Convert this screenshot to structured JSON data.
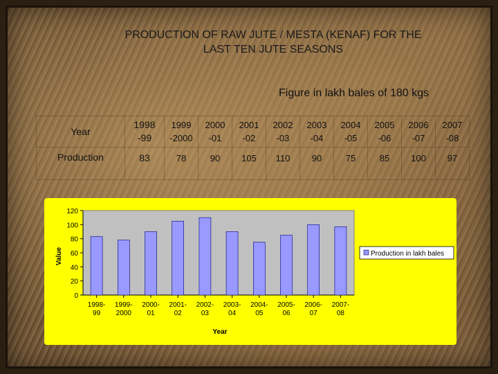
{
  "title_line1": "PRODUCTION OF RAW JUTE / MESTA (KENAF) FOR THE",
  "title_line2": "LAST TEN JUTE SEASONS",
  "unit_note": "Figure in lakh bales of 180 kgs",
  "table": {
    "year_label": "Year",
    "production_label": "Production",
    "years": [
      "1998\n-99",
      "1999\n-2000",
      "2000\n-01",
      "2001\n-02",
      "2002\n-03",
      "2003\n-04",
      "2004\n-05",
      "2005\n-06",
      "2006\n-07",
      "2007\n-08"
    ],
    "production": [
      "83",
      "78",
      "90",
      "105",
      "110",
      "90",
      "75",
      "85",
      "100",
      "97"
    ]
  },
  "colors": {
    "panel": "#ffff00",
    "plot_area": "#c0c0c0",
    "bar": "#9999ff"
  },
  "chart_data": {
    "type": "bar",
    "categories": [
      "1998-99",
      "1999-2000",
      "2000-01",
      "2001-02",
      "2002-03",
      "2003-04",
      "2004-05",
      "2005-06",
      "2006-07",
      "2007-08"
    ],
    "category_label_lines": [
      [
        "1998-",
        "99"
      ],
      [
        "1999-",
        "2000"
      ],
      [
        "2000-",
        "01"
      ],
      [
        "2001-",
        "02"
      ],
      [
        "2002-",
        "03"
      ],
      [
        "2003-",
        "04"
      ],
      [
        "2004-",
        "05"
      ],
      [
        "2005-",
        "06"
      ],
      [
        "2006-",
        "07"
      ],
      [
        "2007-",
        "08"
      ]
    ],
    "series": [
      {
        "name": "Production in lakh bales",
        "values": [
          83,
          78,
          90,
          105,
          110,
          90,
          75,
          85,
          100,
          97
        ]
      }
    ],
    "xlabel": "Year",
    "ylabel": "Value",
    "ylim": [
      0,
      120
    ],
    "yticks": [
      0,
      20,
      40,
      60,
      80,
      100,
      120
    ],
    "grid": false,
    "legend": "right"
  }
}
